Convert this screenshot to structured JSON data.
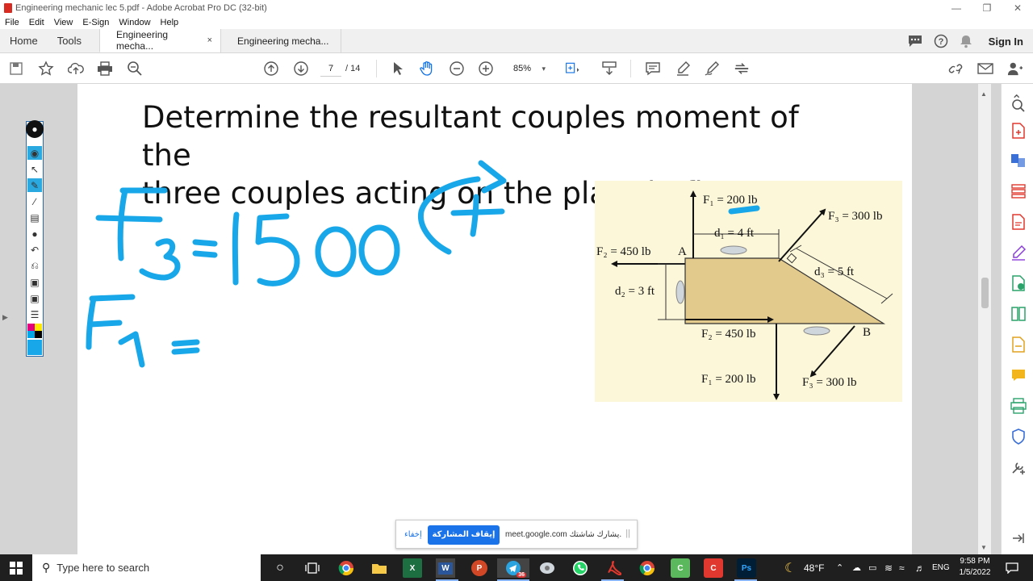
{
  "window": {
    "title": "Engineering mechanic lec 5.pdf - Adobe Acrobat Pro DC (32-bit)"
  },
  "menu": [
    "File",
    "Edit",
    "View",
    "E-Sign",
    "Window",
    "Help"
  ],
  "tabs": {
    "home": "Home",
    "tools": "Tools",
    "doc_tabs": [
      {
        "label": "Engineering mecha...",
        "close": "×"
      },
      {
        "label": "Engineering mecha..."
      }
    ],
    "sign_in": "Sign In"
  },
  "toolbar": {
    "page_current": "7",
    "page_total": "/ 14",
    "zoom": "85%"
  },
  "page": {
    "heading_line1": "Determine the resultant couples moment of the",
    "heading_line2": "three couples acting on the plate in fig."
  },
  "figure": {
    "labels": {
      "f1_top": "F₁ = 200 lb",
      "f3_top": "F₃ = 300 lb",
      "d1": "d₁ = 4 ft",
      "f2_left": "F₂ = 450 lb",
      "point_a": "A",
      "d3": "d₃ = 5 ft",
      "d2": "d₂ = 3 ft",
      "f2_bottom": "F₂ = 450 lb",
      "point_b": "B",
      "f1_bottom": "F₁ = 200 lb",
      "f3_bottom": "F₃ = 300 lb"
    }
  },
  "annotations_ink_color": "#18a8ea",
  "meet": {
    "message": "meet.google.com يشارك شاشتك.",
    "stop_label": "إيقاف المشاركة",
    "hide_label": "إخفاء"
  },
  "taskbar": {
    "search_placeholder": "Type here to search",
    "weather": "48°F",
    "language": "ENG",
    "time": "9:58 PM",
    "date": "1/5/2022",
    "telegram_badge": "36"
  }
}
